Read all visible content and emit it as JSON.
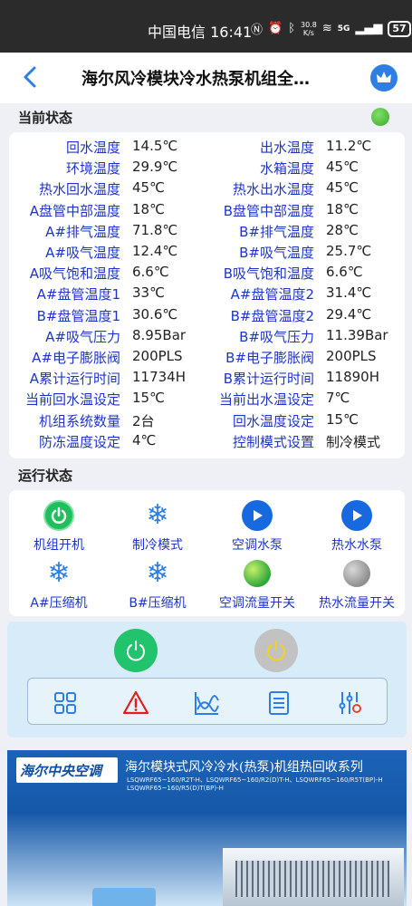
{
  "status_bar": {
    "carrier_time": "中国电信 16:41",
    "speed_value": "30.8",
    "speed_unit": "K/s",
    "network": "5G",
    "battery": "57"
  },
  "header": {
    "title": "海尔风冷模块冷水热泵机组全…"
  },
  "current_status": {
    "label": "当前状态",
    "indicator_color": "#4caf2e",
    "rows": [
      {
        "l1": "回水温度",
        "v1": "14.5℃",
        "l2": "出水温度",
        "v2": "11.2℃"
      },
      {
        "l1": "环境温度",
        "v1": "29.9℃",
        "l2": "水箱温度",
        "v2": "45℃"
      },
      {
        "l1": "热水回水温度",
        "v1": "45℃",
        "l2": "热水出水温度",
        "v2": "45℃"
      },
      {
        "l1": "A盘管中部温度",
        "v1": "18℃",
        "l2": "B盘管中部温度",
        "v2": "18℃"
      },
      {
        "l1": "A#排气温度",
        "v1": "71.8℃",
        "l2": "B#排气温度",
        "v2": "28℃"
      },
      {
        "l1": "A#吸气温度",
        "v1": "12.4℃",
        "l2": "B#吸气温度",
        "v2": "25.7℃"
      },
      {
        "l1": "A吸气饱和温度",
        "v1": "6.6℃",
        "l2": "B吸气饱和温度",
        "v2": "6.6℃"
      },
      {
        "l1": "A#盘管温度1",
        "v1": "33℃",
        "l2": "A#盘管温度2",
        "v2": "31.4℃"
      },
      {
        "l1": "B#盘管温度1",
        "v1": "30.6℃",
        "l2": "B#盘管温度2",
        "v2": "29.4℃"
      },
      {
        "l1": "A#吸气压力",
        "v1": "8.95Bar",
        "l2": "B#吸气压力",
        "v2": "11.39Bar"
      },
      {
        "l1": "A#电子膨胀阀",
        "v1": "200PLS",
        "l2": "B#电子膨胀阀",
        "v2": "200PLS"
      },
      {
        "l1": "A累计运行时间",
        "v1": "11734H",
        "l2": "B累计运行时间",
        "v2": "11890H"
      },
      {
        "l1": "当前回水温设定",
        "v1": "15℃",
        "l2": "当前出水温设定",
        "v2": "7℃"
      },
      {
        "l1": "机组系统数量",
        "v1": "2台",
        "l2": "回水温度设定",
        "v2": "15℃"
      },
      {
        "l1": "防冻温度设定",
        "v1": "4℃",
        "l2": "控制模式设置",
        "v2": "制冷模式"
      }
    ]
  },
  "run_status": {
    "label": "运行状态",
    "items": [
      {
        "label": "机组开机",
        "icon": "power-icon"
      },
      {
        "label": "制冷模式",
        "icon": "snowflake-icon"
      },
      {
        "label": "空调水泵",
        "icon": "play-icon"
      },
      {
        "label": "热水水泵",
        "icon": "play-icon"
      },
      {
        "label": "A#压缩机",
        "icon": "snowflake-icon"
      },
      {
        "label": "B#压缩机",
        "icon": "snowflake-icon"
      },
      {
        "label": "空调流量开关",
        "icon": "green-ball-icon"
      },
      {
        "label": "热水流量开关",
        "icon": "gray-ball-icon"
      }
    ]
  },
  "banner": {
    "logo": "海尔中央空调",
    "title": "海尔模块式风冷冷水(热泵)机组热回收系列",
    "sub1": "LSQWRF65~160/R2T-H、LSQWRF65~160/R2(D)T-H、LSQWRF65~160/R5T(BP)-H",
    "sub2": "LSQWRF65~160/R5(D)T(BP)-H"
  },
  "colors": {
    "label_blue": "#1f35c8",
    "accent_blue": "#2d7fe3",
    "power_green": "#22c36d"
  }
}
